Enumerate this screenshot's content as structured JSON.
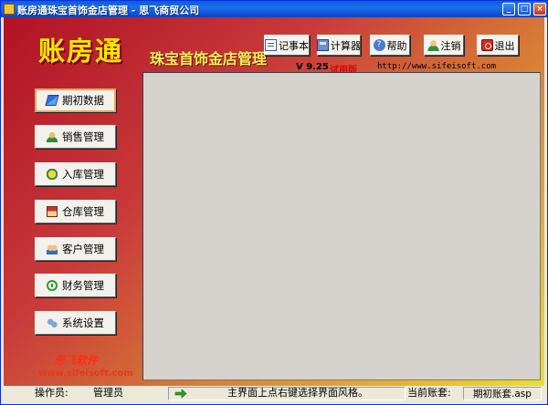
{
  "window": {
    "title": "账房通珠宝首饰金店管理 - 思飞商贸公司",
    "controls": {
      "minimize": "_",
      "maximize": "□",
      "close": "×"
    }
  },
  "header": {
    "logo": "账房通",
    "app_title": "珠宝首饰金店管理",
    "version": "V 9.25",
    "trial": "试用版",
    "url": "http://www.sifeisoft.com"
  },
  "toolbar": {
    "notepad": {
      "label": "记事本",
      "icon": "notepad-icon"
    },
    "calculator": {
      "label": "计算器",
      "icon": "calculator-icon"
    },
    "help": {
      "label": "帮助",
      "icon": "help-icon"
    },
    "logout": {
      "label": "注销",
      "icon": "user-icon"
    },
    "exit": {
      "label": "退出",
      "icon": "exit-icon"
    }
  },
  "sidebar": {
    "items": [
      {
        "label": "期初数据",
        "icon": "book-icon",
        "active": true
      },
      {
        "label": "销售管理",
        "icon": "salesperson-icon"
      },
      {
        "label": "入库管理",
        "icon": "stock-in-icon"
      },
      {
        "label": "仓库管理",
        "icon": "warehouse-icon"
      },
      {
        "label": "客户管理",
        "icon": "customers-icon"
      },
      {
        "label": "财务管理",
        "icon": "finance-icon"
      },
      {
        "label": "系统设置",
        "icon": "settings-icon"
      }
    ]
  },
  "brand": {
    "name": "思飞软件",
    "url": "www.sifeisoft.com"
  },
  "statusbar": {
    "operator_label": "操作员:",
    "operator": "管理员",
    "hint": "主界面上点右键选择界面风格。",
    "account_label": "当前账套:",
    "account": "期初账套.asp"
  },
  "colors": {
    "title_bar": "#0a5fd8",
    "background_gradient_start": "#b01226",
    "background_gradient_end": "#efe026",
    "logo_text": "#ffe600",
    "trial_text": "#e00000",
    "brand_text": "#ff2d14",
    "panel": "#d6d3ce",
    "active_button_border": "#f3a44e"
  }
}
